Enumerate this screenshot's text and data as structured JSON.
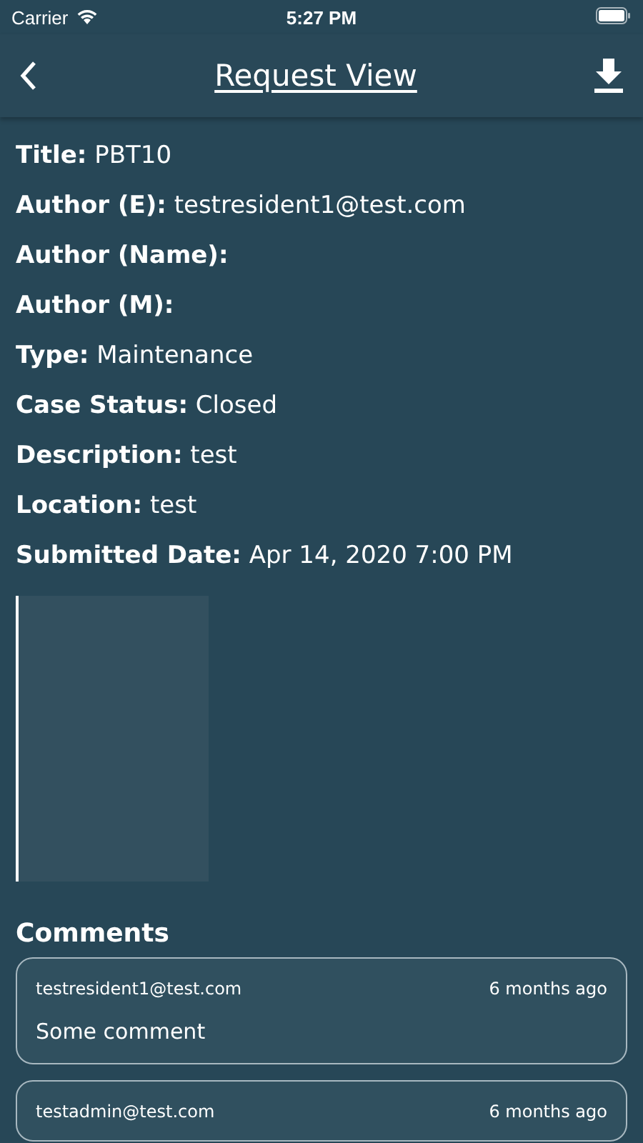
{
  "status_bar": {
    "carrier": "Carrier",
    "time": "5:27 PM"
  },
  "nav": {
    "title": "Request View"
  },
  "fields": [
    {
      "label": "Title:",
      "value": "PBT10"
    },
    {
      "label": "Author (E):",
      "value": "testresident1@test.com"
    },
    {
      "label": "Author (Name):"
    },
    {
      "label": "Author (M):"
    },
    {
      "label": "Type:",
      "value": "Maintenance"
    },
    {
      "label": "Case Status:",
      "value": "Closed"
    },
    {
      "label": "Description:",
      "value": "test"
    },
    {
      "label": "Location:",
      "value": "test"
    },
    {
      "label": "Submitted Date:",
      "value": "Apr 14, 2020 7:00 PM"
    }
  ],
  "comments_heading": "Comments",
  "comments": [
    {
      "author": "testresident1@test.com",
      "time": "6 months ago",
      "text": "Some comment"
    },
    {
      "author": "testadmin@test.com",
      "time": "6 months ago"
    }
  ]
}
